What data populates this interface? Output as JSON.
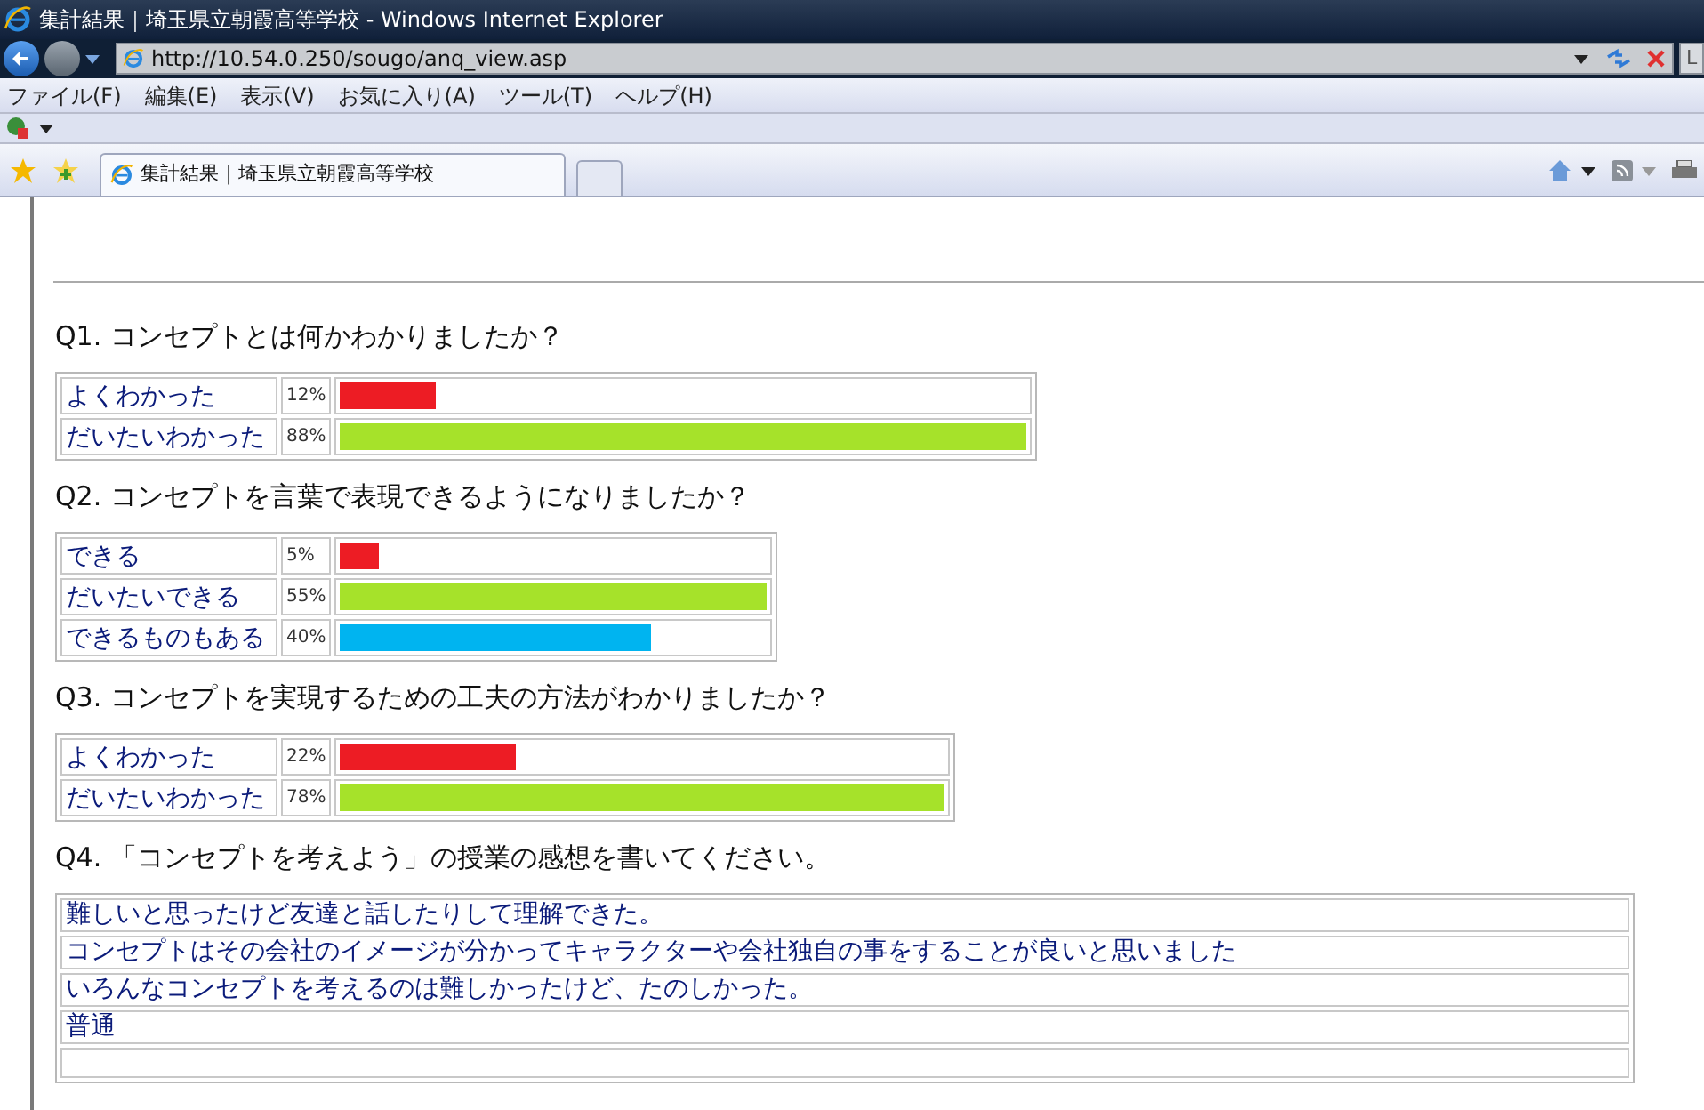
{
  "window": {
    "title": "集計結果｜埼玉県立朝霞高等学校 - Windows Internet Explorer"
  },
  "address_bar": {
    "value": "http://10.54.0.250/sougo/anq_view.asp"
  },
  "search_box": {
    "value": "L"
  },
  "menu": [
    "ファイル(F)",
    "編集(E)",
    "表示(V)",
    "お気に入り(A)",
    "ツール(T)",
    "ヘルプ(H)"
  ],
  "tabs": [
    {
      "label": "集計結果｜埼玉県立朝霞高等学校",
      "selected": true
    }
  ],
  "questions": [
    {
      "kind": "bars",
      "title": "Q1. コンセプトとは何かわかりましたか？",
      "answers": [
        {
          "label": "よくわかった",
          "percent": "12%",
          "level": 0.14,
          "color": "#ed1c24"
        },
        {
          "label": "だいたいわかった",
          "percent": "88%",
          "level": 1,
          "color": "#a6e22a"
        }
      ]
    },
    {
      "kind": "bars",
      "title": "Q2. コンセプトを言葉で表現できるようになりましたか？",
      "answers": [
        {
          "label": "できる",
          "percent": "5%",
          "level": 0.09,
          "color": "#ed1c24"
        },
        {
          "label": "だいたいできる",
          "percent": "55%",
          "level": 1,
          "color": "#a6e22a"
        },
        {
          "label": "できるものもある",
          "percent": "40%",
          "level": 0.73,
          "color": "#00b4f0"
        }
      ]
    },
    {
      "kind": "bars",
      "title": "Q3. コンセプトを実現するための工夫の方法がわかりましたか？",
      "answers": [
        {
          "label": "よくわかった",
          "percent": "22%",
          "level": 0.29,
          "color": "#ed1c24"
        },
        {
          "label": "だいたいわかった",
          "percent": "78%",
          "level": 1,
          "color": "#a6e22a"
        }
      ]
    },
    {
      "kind": "comments",
      "title": "Q4. 「コンセプトを考えよう」の授業の感想を書いてください。",
      "comments": [
        "難しいと思ったけど友達と話したりして理解できた。",
        "コンセプトはその会社のイメージが分かってキャラクターや会社独自の事をすることが良いと思いました",
        "いろんなコンセプトを考えるのは難しかったけど、たのしかった。",
        "普通"
      ]
    }
  ]
}
